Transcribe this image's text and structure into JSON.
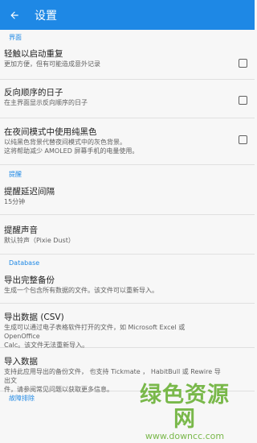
{
  "header": {
    "title": "设置",
    "back_icon": "arrow-left-icon"
  },
  "sections": {
    "interface": "界面",
    "reminder": "提醒",
    "database": "Database",
    "troubleshooting": "故障排除"
  },
  "settings": [
    {
      "title": "轻触以启动重复",
      "subtitle": "更加方便，但有可能造成意外记录",
      "checked": false
    },
    {
      "title": "反向顺序的日子",
      "subtitle": "在主界面显示反向顺序的日子",
      "checked": false
    },
    {
      "title": "在夜间模式中使用纯黑色",
      "subtitle": "以纯黑色背景代替夜间模式中的灰色背景。",
      "subtitle2": "这将帮助减少 AMOLED 屏幕手机的电量使用。",
      "checked": false
    },
    {
      "title": "提醒延迟间隔",
      "subtitle": "15分钟"
    },
    {
      "title": "提醒声音",
      "subtitle": "默认铃声（Pixie Dust）"
    },
    {
      "title": "导出完整备份",
      "subtitle": "生成一个包含所有数据的文件。该文件可以重新导入。"
    },
    {
      "title": "导出数据 (CSV)",
      "subtitle": "生成可以通过电子表格软件打开的文件，如 Microsoft Excel 或 OpenOffice",
      "subtitle2": "Calc。该文件无法重新导入。"
    },
    {
      "title": "导入数据",
      "subtitle": "支持此应用导出的备份文件， 也支持 Tickmate ， HabitBull 或 Rewire 导出文",
      "subtitle2": "件，请参阅常见问题以获取更多信息。"
    }
  ],
  "watermark": {
    "text": "绿色资源网",
    "url": "www.downcc.com"
  },
  "colors": {
    "appbar": "#1e88e5",
    "accent": "#1e88e5",
    "watermark": "#79b84a"
  }
}
